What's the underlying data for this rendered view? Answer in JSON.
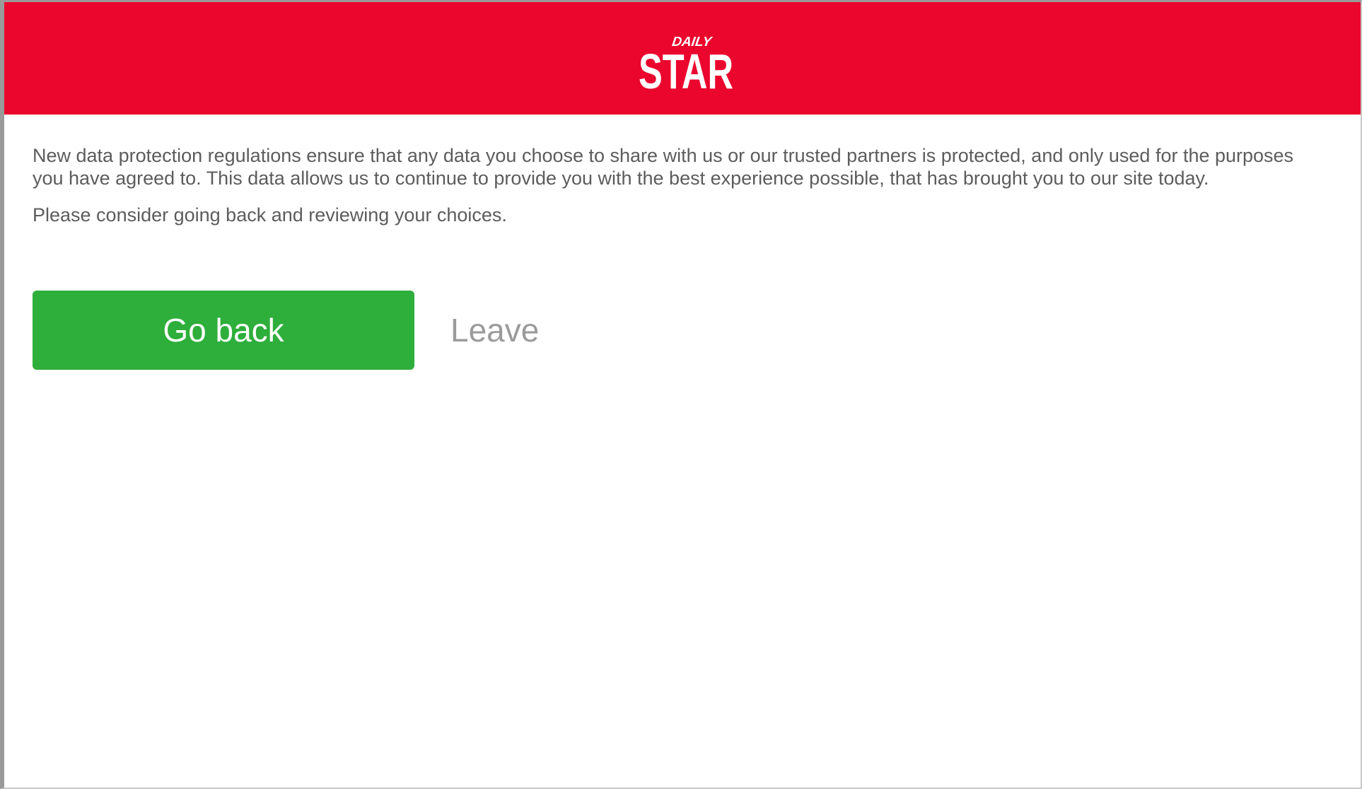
{
  "brand": {
    "logo_top_text": "DAILY",
    "logo_main_text": "STAR",
    "header_color": "#ea062d"
  },
  "message": {
    "paragraph": "New data protection regulations ensure that any data you choose to share with us or our trusted partners is protected, and only used for the purposes you have agreed to. This data allows us to continue to provide you with the best experience possible, that has brought you to our site today.",
    "note": "Please consider going back and reviewing your choices."
  },
  "actions": {
    "go_back_label": "Go back",
    "go_back_color": "#2eae3a",
    "leave_label": "Leave"
  }
}
